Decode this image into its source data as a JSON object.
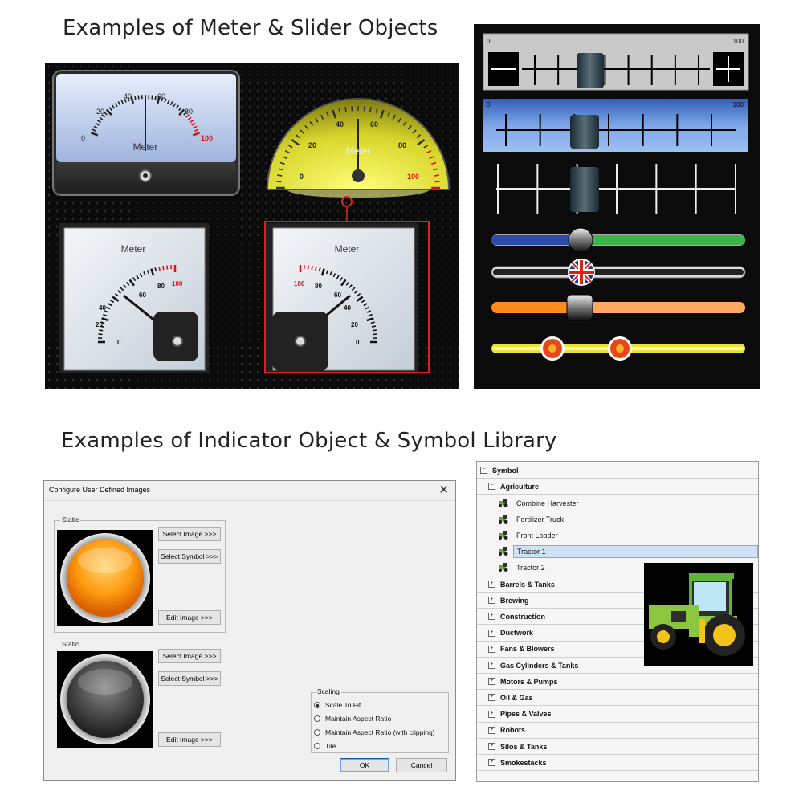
{
  "headings": {
    "meters": "Examples of Meter & Slider Objects",
    "indicators": "Examples of Indicator Object & Symbol Library"
  },
  "meters": {
    "meter_label": "Meter",
    "ticks_0_100": [
      "0",
      "20",
      "40",
      "60",
      "80",
      "100"
    ]
  },
  "sliders": {
    "min_label": "0",
    "max_label": "100",
    "items": [
      {
        "kind": "gray-ruler",
        "value": 0.45
      },
      {
        "kind": "blue-ruler",
        "value": 0.35
      },
      {
        "kind": "plain-ruler",
        "value": 0.35
      },
      {
        "kind": "blue-green-bar",
        "value": 0.35
      },
      {
        "kind": "flag-bar",
        "value": 0.38
      },
      {
        "kind": "orange-bar",
        "value": 0.34
      },
      {
        "kind": "flower-bar",
        "values": [
          0.24,
          0.5
        ]
      }
    ]
  },
  "dialog": {
    "title": "Configure User Defined Images",
    "close": "✕",
    "static_1": "Static",
    "static_2": "Static",
    "select_image": "Select Image >>>",
    "select_symbol": "Select Symbol >>>",
    "edit_image": "Edit Image >>>",
    "scaling": {
      "label": "Scaling",
      "options": [
        "Scale To Fit",
        "Maintain Aspect Ratio",
        "Maintain Aspect Ratio (with clipping)",
        "Tile"
      ],
      "selected": "Scale To Fit"
    },
    "ok": "OK",
    "cancel": "Cancel"
  },
  "symbol_tree": {
    "root": "Symbol",
    "expanded": "Agriculture",
    "children": [
      "Combine Harvester",
      "Fertilizer Truck",
      "Front Loader",
      "Tractor 1",
      "Tractor 2"
    ],
    "selected": "Tractor 1",
    "categories": [
      "Barrels & Tanks",
      "Brewing",
      "Construction",
      "Ductwork",
      "Fans & Blowers",
      "Gas Cylinders & Tanks",
      "Motors & Pumps",
      "Oil & Gas",
      "Pipes & Valves",
      "Robots",
      "Silos & Tanks",
      "Smokestacks"
    ]
  },
  "colors": {
    "slider_blue": "#4a7fd0",
    "highlight": "#cfe3f5",
    "orange": "#ff8a1e",
    "yellow_gauge": "#c9c51a",
    "red_mark": "#e01010",
    "selection_red": "#e02020"
  }
}
